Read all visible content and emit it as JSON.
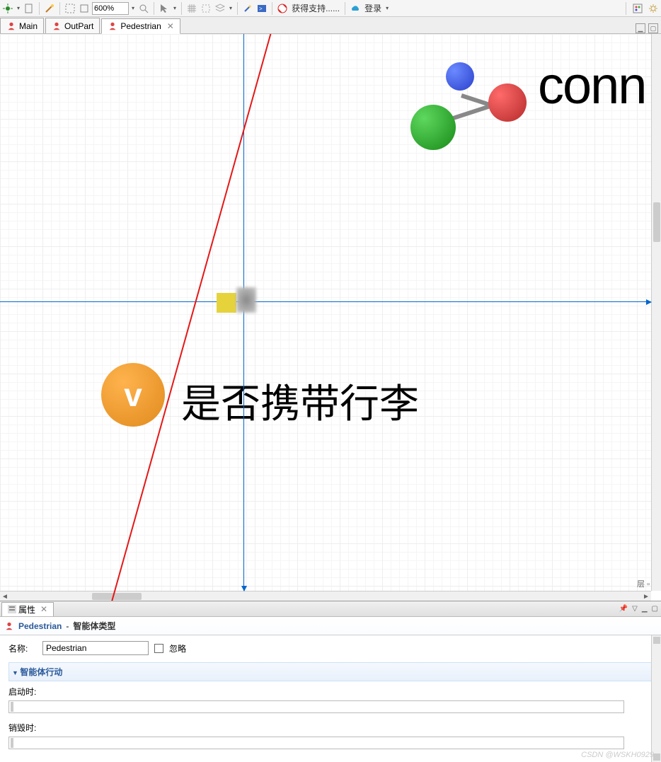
{
  "toolbar": {
    "zoom": "600%",
    "support": "获得支持......",
    "login": "登录"
  },
  "tabs": [
    {
      "label": "Main"
    },
    {
      "label": "OutPart"
    },
    {
      "label": "Pedestrian"
    }
  ],
  "canvas": {
    "conn_label": "conn",
    "variable_label": "是否携带行李",
    "variable_marker": "v",
    "layer_label": "层"
  },
  "properties": {
    "tab_label": "属性",
    "title": "Pedestrian",
    "subtitle": "智能体类型",
    "name_label": "名称:",
    "name_value": "Pedestrian",
    "ignore_label": "忽略",
    "section_actions": "智能体行动",
    "on_startup_label": "启动时:",
    "on_destroy_label": "销毁时:"
  },
  "watermark": "CSDN @WSKH0929"
}
